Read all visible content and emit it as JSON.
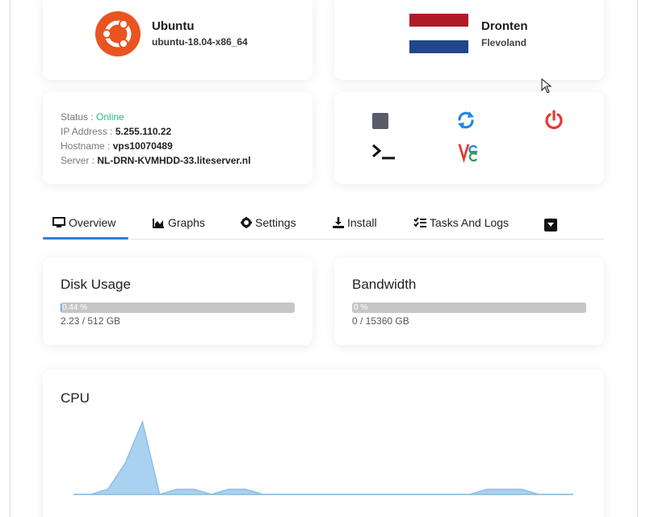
{
  "os": {
    "name": "Ubuntu",
    "version": "ubuntu-18.04-x86_64",
    "brand_color": "#e95420"
  },
  "location": {
    "city": "Dronten",
    "region": "Flevoland",
    "flag_colors": [
      "#ae1c28",
      "#ffffff",
      "#21468b"
    ]
  },
  "server": {
    "status_label": "Status :",
    "status_value": "Online",
    "ip_label": "IP Address :",
    "ip_value": "5.255.110.22",
    "hostname_label": "Hostname :",
    "hostname_value": "vps10070489",
    "server_label": "Server :",
    "server_value": "NL-DRN-KVMHDD-33.liteserver.nl"
  },
  "actions": {
    "stop_icon": "stop-icon",
    "restart_icon": "refresh-icon",
    "power_icon": "power-icon",
    "console_icon": "terminal-icon",
    "vnc_icon": "vnc-icon",
    "colors": {
      "stop": "#5b5b6b",
      "restart": "#1e88e5",
      "power": "#e53935"
    }
  },
  "tabs": [
    {
      "label": "Overview",
      "icon": "monitor-icon",
      "active": true
    },
    {
      "label": "Graphs",
      "icon": "area-chart-icon"
    },
    {
      "label": "Settings",
      "icon": "gear-icon"
    },
    {
      "label": "Install",
      "icon": "download-icon"
    },
    {
      "label": "Tasks And Logs",
      "icon": "tasks-icon"
    }
  ],
  "disk": {
    "title": "Disk Usage",
    "percent_label": "0.44 %",
    "percent": 0.44,
    "used": "2.23 / 512 GB"
  },
  "bandwidth": {
    "title": "Bandwidth",
    "percent_label": "0 %",
    "percent": 0,
    "used": "0 / 15360 GB"
  },
  "cpu": {
    "title": "CPU",
    "series_color": "#a9d1f0",
    "values": [
      0,
      0,
      2,
      12,
      28,
      0,
      2,
      2,
      0,
      2,
      2,
      0,
      0,
      0,
      0,
      0,
      0,
      0,
      0,
      0,
      0,
      0,
      0,
      0,
      2,
      2,
      2,
      0,
      0,
      0
    ]
  },
  "accent_color": "#2f7fd6"
}
